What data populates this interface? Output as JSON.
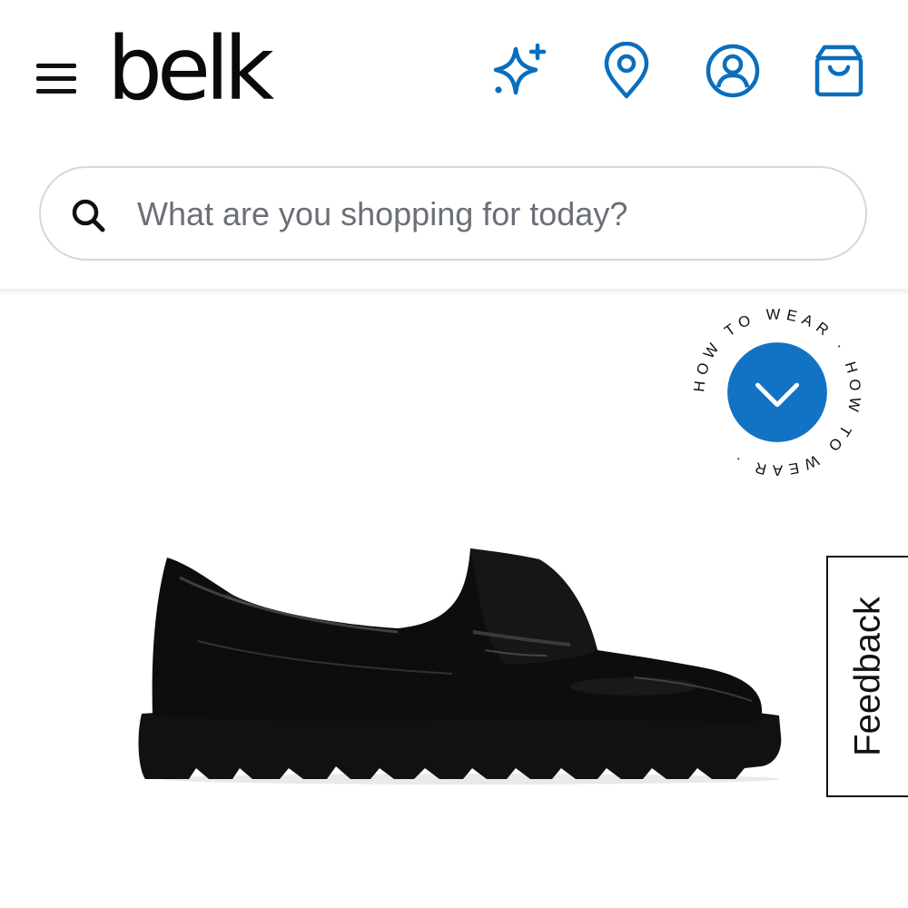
{
  "header": {
    "logo_text": "belk",
    "icons": {
      "menu": "hamburger-menu-icon",
      "sparkle": "sparkle-icon",
      "location": "location-pin-icon",
      "account": "account-icon",
      "bag": "shopping-bag-icon"
    },
    "accent_color": "#0a6ebd"
  },
  "search": {
    "placeholder": "What are you shopping for today?",
    "value": ""
  },
  "how_to_wear": {
    "ring_text": "HOW TO WEAR · HOW TO WEAR · ",
    "button_color": "#1273c4"
  },
  "product": {
    "image_subject": "black patent leather platform penny loafer"
  },
  "feedback": {
    "label": "Feedback"
  }
}
